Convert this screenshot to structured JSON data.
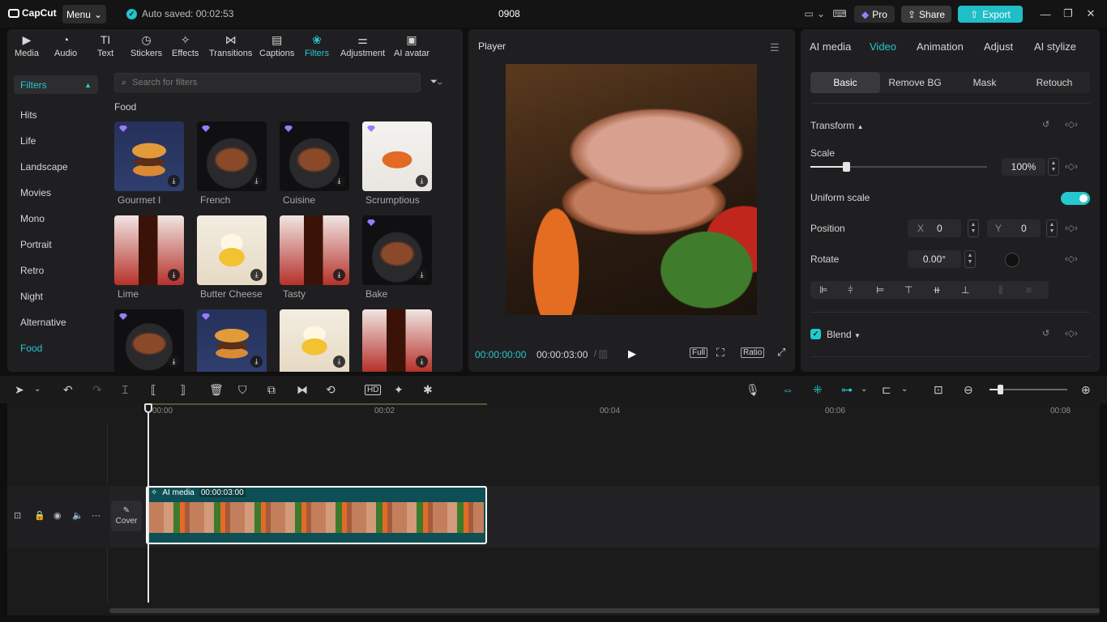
{
  "app": {
    "brand": "CapCut",
    "menu_label": "Menu",
    "autosave": "Auto saved: 00:02:53",
    "project_name": "0908",
    "pro_label": "Pro",
    "share_label": "Share",
    "export_label": "Export"
  },
  "left_panel": {
    "tools": [
      {
        "label": "Media",
        "icon": "media-icon"
      },
      {
        "label": "Audio",
        "icon": "audio-icon"
      },
      {
        "label": "Text",
        "icon": "text-icon"
      },
      {
        "label": "Stickers",
        "icon": "stickers-icon"
      },
      {
        "label": "Effects",
        "icon": "effects-icon"
      },
      {
        "label": "Transitions",
        "icon": "transitions-icon"
      },
      {
        "label": "Captions",
        "icon": "captions-icon"
      },
      {
        "label": "Filters",
        "icon": "filters-icon",
        "active": true
      },
      {
        "label": "Adjustment",
        "icon": "adjustment-icon"
      },
      {
        "label": "AI avatar",
        "icon": "ai-avatar-icon"
      }
    ],
    "category_header": "Filters",
    "categories": [
      "Hits",
      "Life",
      "Landscape",
      "Movies",
      "Mono",
      "Portrait",
      "Retro",
      "Night",
      "Alternative",
      "Food"
    ],
    "active_category": "Food",
    "search_placeholder": "Search for filters",
    "section": "Food",
    "filters": [
      "Gourmet I",
      "French",
      "Cuisine",
      "Scrumptious",
      "Lime",
      "Butter Cheese",
      "Tasty",
      "Bake"
    ]
  },
  "player": {
    "title": "Player",
    "current_time": "00:00:00:00",
    "duration": "00:00:03:00",
    "full_label": "Full",
    "ratio_label": "Ratio"
  },
  "right_panel": {
    "tabs": [
      "AI media",
      "Video",
      "Animation",
      "Adjust",
      "AI stylize"
    ],
    "active_tab": "Video",
    "subtabs": [
      "Basic",
      "Remove BG",
      "Mask",
      "Retouch"
    ],
    "active_subtab": "Basic",
    "transform_label": "Transform",
    "scale_label": "Scale",
    "scale_value": "100%",
    "scale_fraction": 0.2,
    "uniform_scale_label": "Uniform scale",
    "position_label": "Position",
    "pos_x_label": "X",
    "pos_x": "0",
    "pos_y_label": "Y",
    "pos_y": "0",
    "rotate_label": "Rotate",
    "rotate_value": "0.00°",
    "blend_label": "Blend"
  },
  "timeline": {
    "ruler": [
      "00:00",
      "00:02",
      "00:04",
      "00:06",
      "00:08"
    ],
    "clip_label": "AI media",
    "clip_duration": "00:00:03:00",
    "cover_label": "Cover"
  },
  "colors": {
    "accent": "#25c8cf",
    "panel": "#1f1f21",
    "clip": "#0d4f55"
  }
}
